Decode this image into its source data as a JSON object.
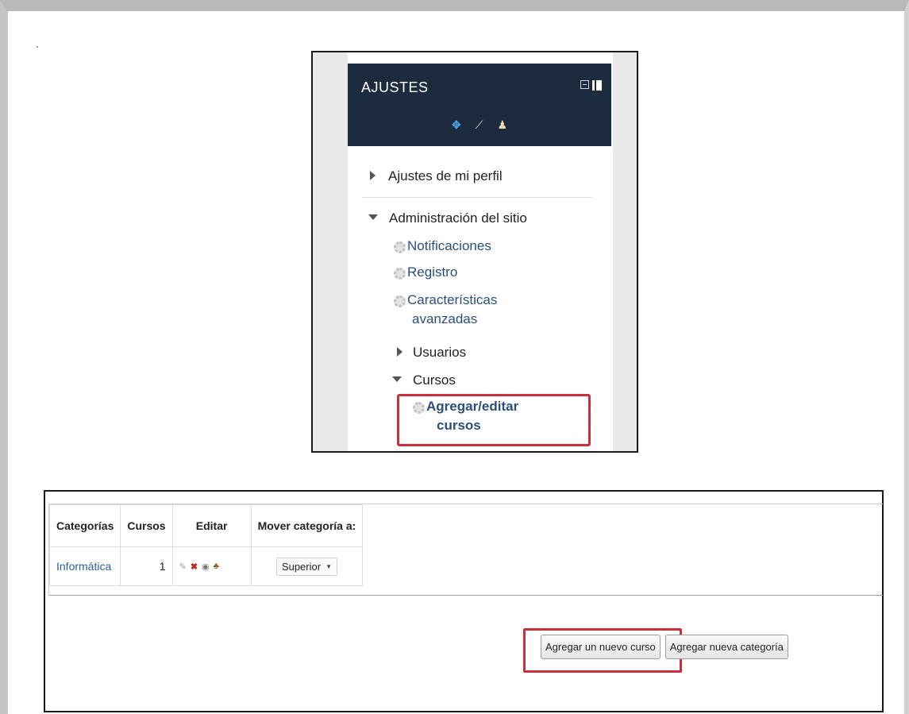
{
  "settings_block": {
    "title": "AJUSTES",
    "icons": [
      "move-icon",
      "wrench-icon",
      "user-icon"
    ],
    "tree": {
      "profile_settings": "Ajustes de mi perfil",
      "site_admin": "Administración del sitio",
      "notifications": "Notificaciones",
      "registration": "Registro",
      "advanced_features_line1": "Características",
      "advanced_features_line2": "avanzadas",
      "users": "Usuarios",
      "courses": "Cursos",
      "add_edit_courses_line1": "Agregar/editar",
      "add_edit_courses_line2": "cursos"
    }
  },
  "categories_table": {
    "headers": [
      "Categorías",
      "Cursos",
      "Editar",
      "Mover categoría a:"
    ],
    "rows": [
      {
        "category": "Informática",
        "courses": "1",
        "move_to": "Superior"
      }
    ]
  },
  "buttons": {
    "add_course": "Agregar un nuevo curso",
    "add_category": "Agregar nueva categoría"
  },
  "colors": {
    "header_bg": "#1d2b3e",
    "highlight": "#c9303b",
    "link": "#2a4f7a"
  }
}
